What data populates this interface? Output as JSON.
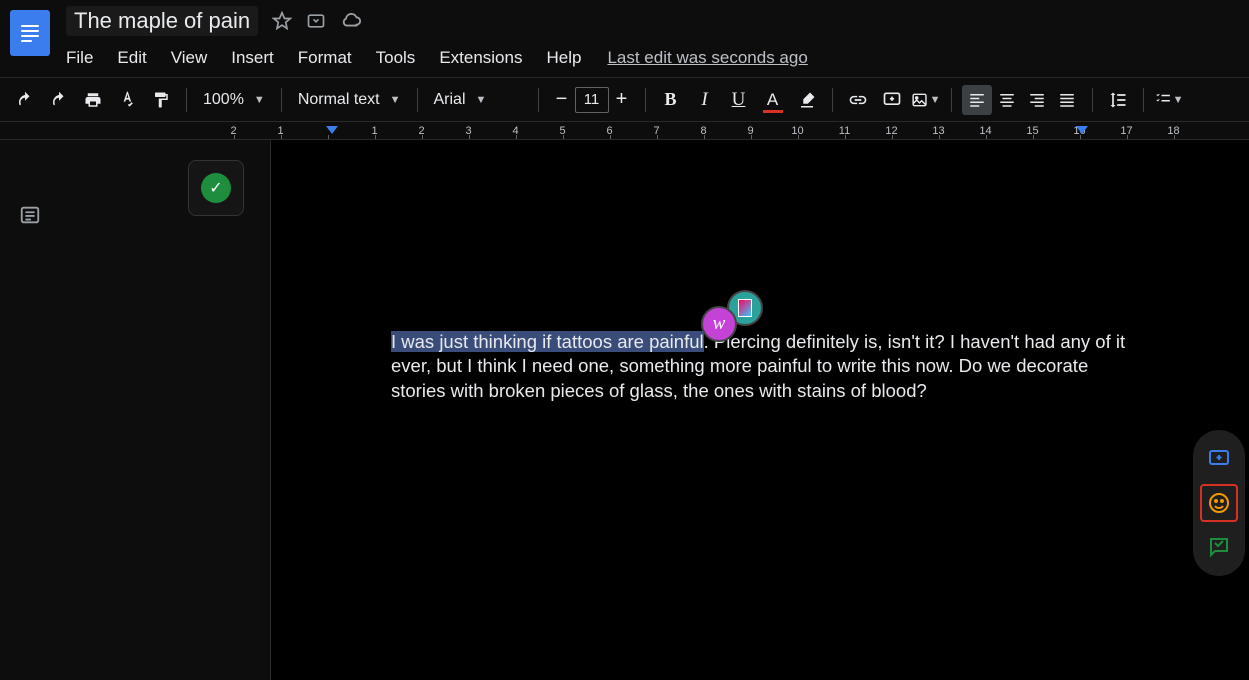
{
  "document": {
    "title": "The maple of pain",
    "selected_text": "I was just thinking if tattoos are painful",
    "body_rest": ". Piercing definitely is, isn't it? I haven't had any of it ever, but I think I need one, something more painful to write this now. Do we decorate stories with broken pieces of glass, the ones with stains of blood?"
  },
  "menus": {
    "file": "File",
    "edit": "Edit",
    "view": "View",
    "insert": "Insert",
    "format": "Format",
    "tools": "Tools",
    "extensions": "Extensions",
    "help": "Help",
    "last_edit": "Last edit was seconds ago"
  },
  "toolbar": {
    "zoom": "100%",
    "style": "Normal text",
    "font": "Arial",
    "font_size": "11"
  },
  "ruler": {
    "marks": [
      "2",
      "1",
      "",
      "1",
      "2",
      "3",
      "4",
      "5",
      "6",
      "7",
      "8",
      "9",
      "10",
      "11",
      "12",
      "13",
      "14",
      "15",
      "16",
      "17",
      "18"
    ]
  },
  "collaborator": {
    "initial": "w"
  }
}
